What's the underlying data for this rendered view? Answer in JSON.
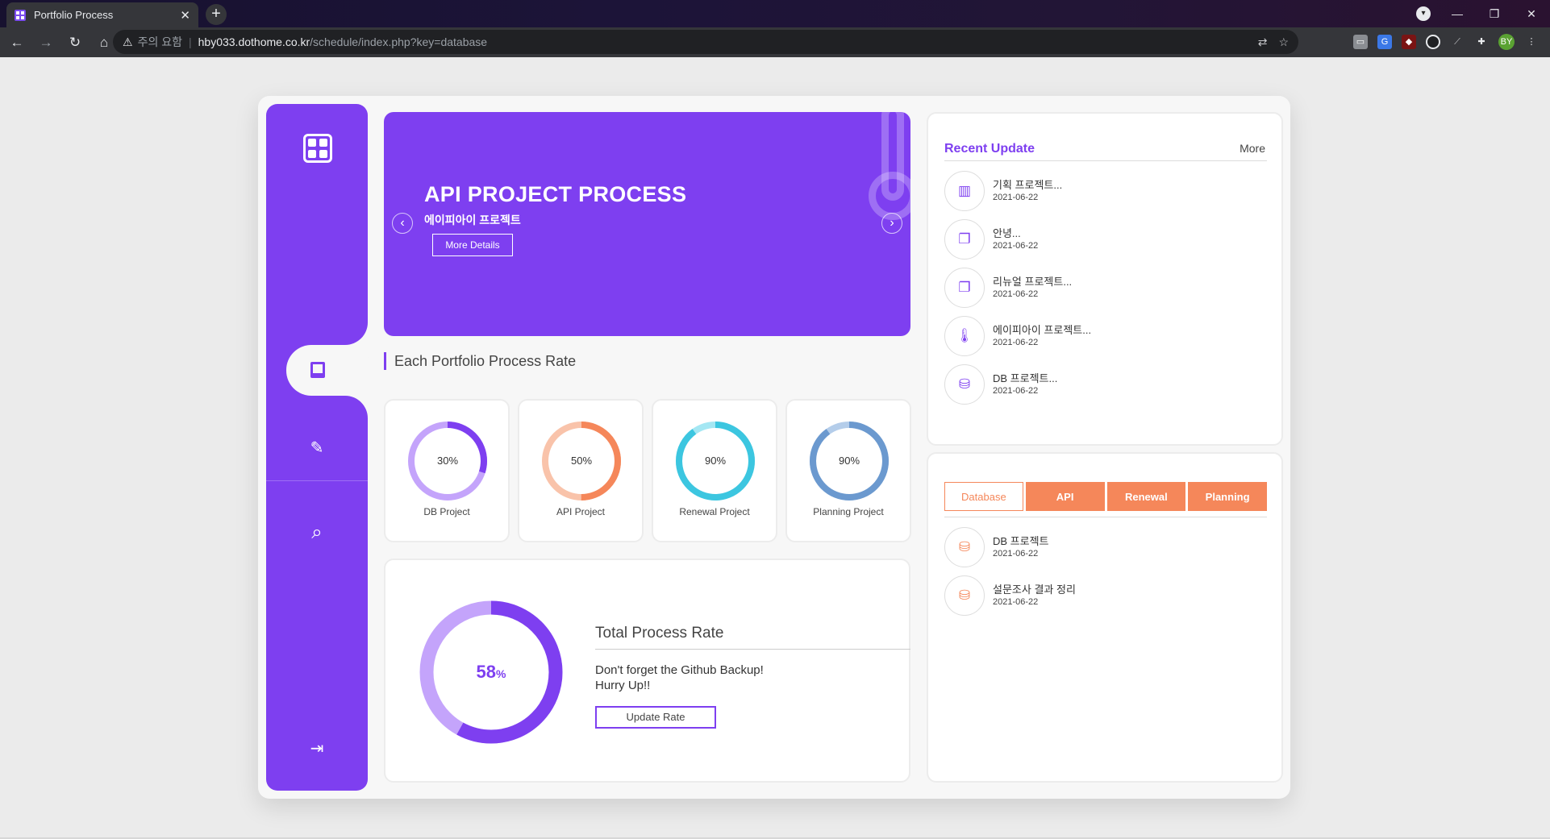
{
  "browser": {
    "tab_title": "Portfolio Process",
    "tab_close": "✕",
    "new_tab": "+",
    "security_label": "주의 요함",
    "url_host": "hby033.dothome.co.kr",
    "url_path": "/schedule/index.php?key=database",
    "profile_initials": "BY",
    "window": {
      "minimize": "—",
      "restore": "❐",
      "close": "✕"
    }
  },
  "sidebar": {
    "logo_icon": "dashboard-grid-icon",
    "items": [
      {
        "name": "board",
        "icon": "kanban-icon",
        "active": true
      },
      {
        "name": "edit",
        "icon": "pencil-icon",
        "glyph": "✎"
      },
      {
        "name": "search",
        "icon": "search-icon",
        "glyph": "⌕"
      },
      {
        "name": "logout",
        "icon": "sign-out-icon",
        "glyph": "⇥"
      }
    ]
  },
  "banner": {
    "title": "API PROJECT PROCESS",
    "subtitle": "에이피아이 프로젝트",
    "button_label": "More Details",
    "prev": "‹",
    "next": "›",
    "decoration_icon": "thermometer-icon"
  },
  "section": {
    "title": "Each Portfolio Process Rate"
  },
  "projects": [
    {
      "label": "DB Project",
      "percent": 30,
      "rate_text": "30%",
      "color": "#7e3ff0",
      "track": "#c4a4fb"
    },
    {
      "label": "API Project",
      "percent": 50,
      "rate_text": "50%",
      "color": "#f5875a",
      "track": "#f9c3aa"
    },
    {
      "label": "Renewal Project",
      "percent": 90,
      "rate_text": "90%",
      "color": "#3cc6e0",
      "track": "#a4e7f3"
    },
    {
      "label": "Planning Project",
      "percent": 90,
      "rate_text": "90%",
      "color": "#6b99cf",
      "track": "#b4cdea"
    }
  ],
  "total": {
    "percent": 58,
    "value": "58",
    "unit": "%",
    "title": "Total Process Rate",
    "message_line1": "Don't forget the Github Backup!",
    "message_line2": "Hurry Up!!",
    "button_label": "Update Rate",
    "color": "#7e3ff0",
    "track": "#c4a4fb"
  },
  "recent": {
    "title": "Recent Update",
    "more": "More",
    "items": [
      {
        "title": "기획 프로젝트...",
        "date": "2021-06-22",
        "icon": "bar-chart-icon",
        "glyph": "▥"
      },
      {
        "title": "안녕...",
        "date": "2021-06-22",
        "icon": "copy-icon",
        "glyph": "❐"
      },
      {
        "title": "리뉴얼 프로젝트...",
        "date": "2021-06-22",
        "icon": "copy-icon",
        "glyph": "❐"
      },
      {
        "title": "에이피아이 프로젝트...",
        "date": "2021-06-22",
        "icon": "thermometer-icon",
        "glyph": "🌡"
      },
      {
        "title": "DB 프로젝트...",
        "date": "2021-06-22",
        "icon": "database-icon",
        "glyph": "⛁"
      }
    ]
  },
  "category": {
    "tabs": [
      {
        "label": "Database",
        "active": true
      },
      {
        "label": "API",
        "active": false
      },
      {
        "label": "Renewal",
        "active": false
      },
      {
        "label": "Planning",
        "active": false
      }
    ],
    "items": [
      {
        "title": "DB 프로젝트",
        "date": "2021-06-22",
        "icon": "database-icon",
        "glyph": "⛁"
      },
      {
        "title": "설문조사 결과 정리",
        "date": "2021-06-22",
        "icon": "database-icon",
        "glyph": "⛁"
      }
    ],
    "accent": "#f5875a"
  }
}
